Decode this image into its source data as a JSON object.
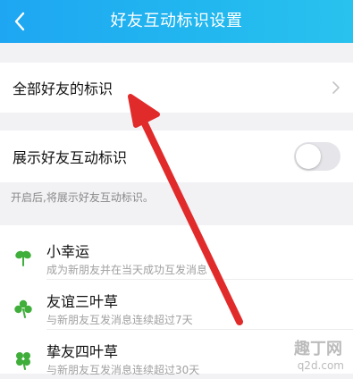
{
  "header": {
    "title": "好友互动标识设置"
  },
  "all_friends_row": {
    "label": "全部好友的标识"
  },
  "show_row": {
    "label": "展示好友互动标识",
    "toggle_on": false
  },
  "hint": "开启后,将展示好友互动标识。",
  "items": [
    {
      "name": "小幸运",
      "desc": "成为新朋友并在当天成功互发消息",
      "icon": "two-leaf-clover-icon"
    },
    {
      "name": "友谊三叶草",
      "desc": "与新朋友互发消息连续超过7天",
      "icon": "three-leaf-clover-icon"
    },
    {
      "name": "挚友四叶草",
      "desc": "与新朋友互发消息连续超过30天",
      "icon": "four-leaf-clover-icon"
    }
  ],
  "watermark": {
    "big": "趣丁网",
    "small": "q2d.com"
  },
  "colors": {
    "header_start": "#1ea6f2",
    "header_end": "#29c2ee",
    "clover_green": "#3fae3a",
    "annotation_arrow": "#e12b2b"
  }
}
